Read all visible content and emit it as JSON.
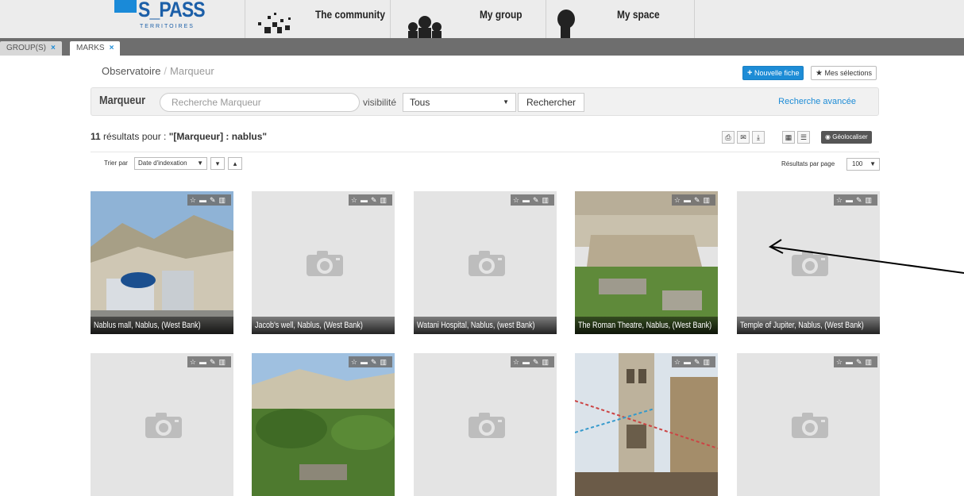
{
  "nav": {
    "logo_text": "S_PASS",
    "logo_sub": "TERRITOIRES",
    "items": [
      {
        "label": "The community"
      },
      {
        "label": "My group"
      },
      {
        "label": "My space"
      }
    ]
  },
  "tabs": [
    {
      "label": "GROUP(S)",
      "close": "×"
    },
    {
      "label": "MARKS",
      "close": "×"
    }
  ],
  "breadcrumb": {
    "root": "Observatoire",
    "separator": "/",
    "current": "Marqueur"
  },
  "actions": {
    "new_sheet": "Nouvelle fiche",
    "new_icon": "+",
    "my_selections": "Mes sélections",
    "star": "★"
  },
  "search": {
    "title": "Marqueur",
    "placeholder": "Recherche Marqueur",
    "visibility_label": "visibilité",
    "visibility_value": "Tous",
    "button": "Rechercher",
    "advanced": "Recherche avancée"
  },
  "results": {
    "count": "11",
    "text": " résultats pour : ",
    "query": "\"[Marqueur] : nablus\""
  },
  "toolbar": {
    "print_icon": "⎙",
    "mail_icon": "✉",
    "download_icon": "⤓",
    "grid_icon": "▦",
    "list_icon": "☰",
    "geolocate": "Géolocaliser"
  },
  "sorting": {
    "label": "Trier par",
    "value": "Date d'indexation",
    "down": "▾",
    "up": "▴",
    "per_page_label": "Résultats par page",
    "per_page_value": "100"
  },
  "card_actions": "☆ ▬ ✎ 🗑",
  "cards": [
    {
      "caption": "Nablus mall, Nablus, (West Bank)",
      "image": "photo-city"
    },
    {
      "caption": "Jacob's well, Nablus, (West Bank)",
      "image": "placeholder"
    },
    {
      "caption": "Watani Hospital, Nablus, (west Bank)",
      "image": "placeholder"
    },
    {
      "caption": "The Roman Theatre, Nablus, (West Bank)",
      "image": "photo-ruins"
    },
    {
      "caption": "Temple of Jupiter, Nablus, (West Bank)",
      "image": "placeholder"
    },
    {
      "caption": "",
      "image": "placeholder"
    },
    {
      "caption": "",
      "image": "photo-garden"
    },
    {
      "caption": "",
      "image": "placeholder"
    },
    {
      "caption": "",
      "image": "photo-tower"
    },
    {
      "caption": "",
      "image": "placeholder"
    }
  ],
  "colors": {
    "accent": "#1d8cd6",
    "tabbar": "#6e6e6e",
    "card_bg": "#e4e4e4"
  }
}
